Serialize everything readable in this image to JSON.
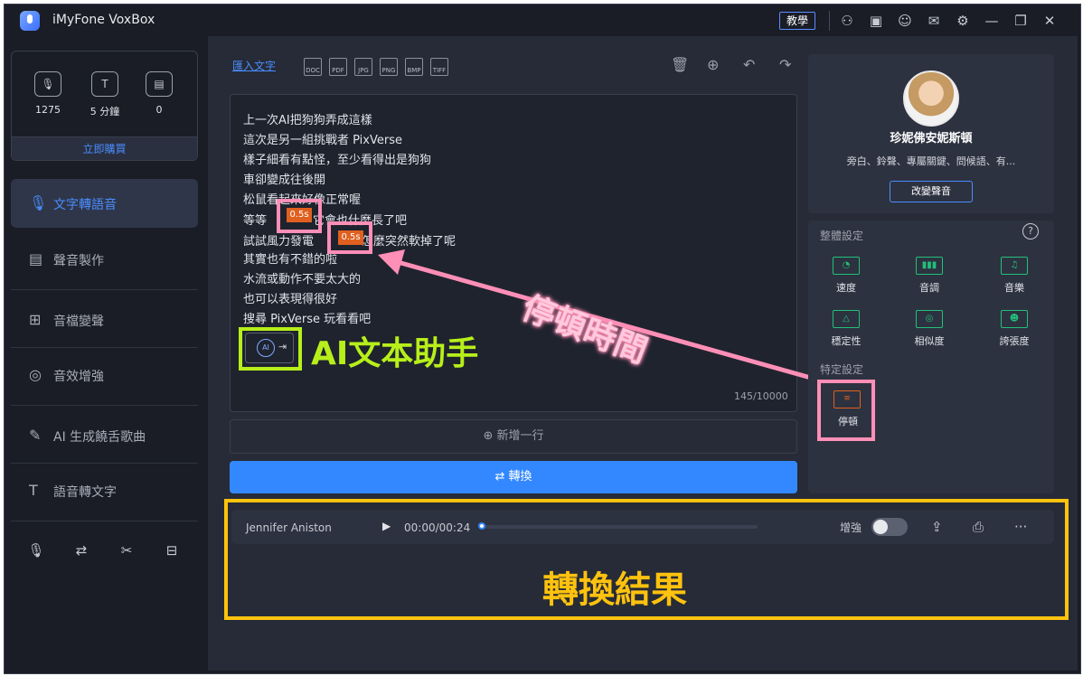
{
  "app": {
    "title": "iMyFone VoxBox",
    "tag": "教學"
  },
  "titlebar_icons": [
    "user-icon",
    "app-icon",
    "discord-icon",
    "mail-icon",
    "settings-icon",
    "minimize-icon",
    "maximize-icon",
    "close-icon"
  ],
  "titlebar_glyphs": {
    "user": "⚇",
    "app": "▣",
    "discord": "☺",
    "mail": "✉",
    "settings": "⚙",
    "min": "—",
    "max": "❐",
    "close": "✕"
  },
  "account": {
    "stats": [
      {
        "value": "1275",
        "glyph": "🎙"
      },
      {
        "value": "5 分鐘",
        "glyph": "T"
      },
      {
        "value": "0",
        "glyph": "▤"
      }
    ],
    "buy_label": "立即購買"
  },
  "sidebar": {
    "items": [
      {
        "label": "文字轉語音",
        "glyph": "🎙"
      },
      {
        "label": "聲音製作",
        "glyph": "▤"
      },
      {
        "label": "音檔變聲",
        "glyph": "⊞"
      },
      {
        "label": "音效增強",
        "glyph": "◎"
      },
      {
        "label": "AI 生成饒舌歌曲",
        "glyph": "✎"
      },
      {
        "label": "語音轉文字",
        "glyph": "T"
      }
    ],
    "bottom_glyphs": [
      "🎙",
      "⇄",
      "✂",
      "⊟"
    ]
  },
  "toolbar": {
    "import_label": "匯入文字",
    "file_types": [
      "DOC",
      "PDF",
      "JPG",
      "PNG",
      "BMP",
      "TIFF"
    ],
    "action_glyphs": [
      "🗑",
      "⊕",
      "↶",
      "↷"
    ]
  },
  "editor": {
    "lines": [
      "上一次AI把狗狗弄成這樣",
      "這次是另一組挑戰者 PixVerse",
      "樣子細看有點怪，至少看得出是狗狗",
      "車卻變成往後開",
      "松鼠看起來好像正常喔",
      "等等",
      "試試風力發電",
      "其實也有不錯的啦",
      "水流或動作不要太大的",
      "也可以表現得很好",
      "搜尋 PixVerse 玩看看吧"
    ],
    "line6_tail": "它會也什麼長了吧",
    "line7_tail": "怎麼突然軟掉了呢",
    "pauses": [
      "0.5s",
      "0.5s"
    ],
    "counter": "145/10000",
    "ai_button": {
      "badge": "AI",
      "arrow": "⇥"
    }
  },
  "annotations": {
    "ai_assistant": "AI文本助手",
    "pause_time": "停頓時間",
    "result": "轉換結果"
  },
  "add_line_label": "新增一行",
  "add_line_glyph": "⊕",
  "convert_label": "轉換",
  "convert_glyph": "⇄",
  "voice": {
    "name": "珍妮佛安妮斯頓",
    "tags": "旁白、鈴聲、專屬關鍵、問候語、有...",
    "change_label": "改變聲音"
  },
  "settings": {
    "global_label": "整體設定",
    "help_glyph": "?",
    "items": [
      {
        "label": "速度",
        "glyph": "◔"
      },
      {
        "label": "音調",
        "glyph": "▮▮▮"
      },
      {
        "label": "音樂",
        "glyph": "♫"
      },
      {
        "label": "穩定性",
        "glyph": "△"
      },
      {
        "label": "相似度",
        "glyph": "◎"
      },
      {
        "label": "誇張度",
        "glyph": "☻"
      }
    ],
    "specific_label": "特定設定",
    "pause_label": "停頓",
    "pause_glyph": "≡"
  },
  "player": {
    "voice_name": "Jennifer Aniston",
    "play_glyph": "▶",
    "time": "00:00/00:24",
    "progress": 0,
    "enhance_label": "增強",
    "enhance_on": false,
    "glyphs": {
      "export": "⇪",
      "save": "⎙",
      "more": "···"
    }
  },
  "colors": {
    "accent": "#3388ff",
    "pause": "#e0601f",
    "green": "#22c07a",
    "annotation_pink": "#ff8fb7",
    "annotation_green": "#b7ef1a",
    "annotation_yellow": "#ffc20e"
  }
}
